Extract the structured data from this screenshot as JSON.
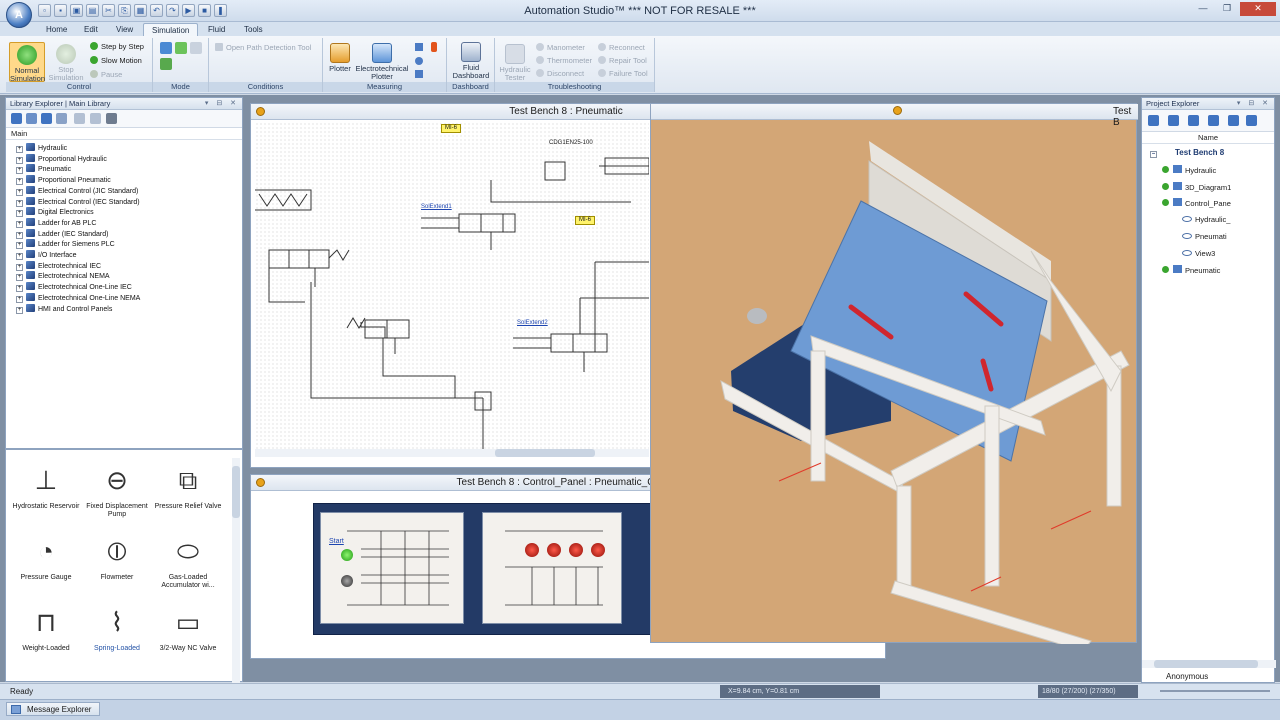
{
  "window": {
    "title": "Automation Studio™   *** NOT FOR RESALE ***",
    "logo_text": "A"
  },
  "ribbon_tabs": [
    "Home",
    "Edit",
    "View",
    "Simulation",
    "Fluid",
    "Tools"
  ],
  "ribbon": {
    "control": {
      "label": "Control",
      "normal_simulation": "Normal Simulation",
      "stop_simulation": "Stop Simulation",
      "step_by_step": "Step by Step",
      "slow_motion": "Slow Motion",
      "pause": "Pause"
    },
    "mode": {
      "label": "Mode"
    },
    "conditions": {
      "label": "Conditions",
      "open_path": "Open Path Detection Tool"
    },
    "measuring": {
      "label": "Measuring",
      "plotter": "Plotter",
      "electrotechnical_plotter": "Electrotechnical Plotter"
    },
    "dashboard": {
      "label": "Dashboard",
      "fluid_dashboard": "Fluid Dashboard"
    },
    "troubleshooting": {
      "label": "Troubleshooting",
      "hydraulic_tester": "Hydraulic Tester",
      "manometer": "Manometer",
      "thermometer": "Thermometer",
      "disconnect": "Disconnect",
      "reconnect": "Reconnect",
      "repair_tool": "Repair Tool",
      "failure_tool": "Failure Tool"
    }
  },
  "library": {
    "title": "Library Explorer | Main Library",
    "column": "Main",
    "items": [
      "Hydraulic",
      "Proportional Hydraulic",
      "Pneumatic",
      "Proportional Pneumatic",
      "Electrical Control (JIC Standard)",
      "Electrical Control (IEC Standard)",
      "Digital Electronics",
      "Ladder for AB PLC",
      "Ladder (IEC Standard)",
      "Ladder for Siemens PLC",
      "I/O Interface",
      "Electrotechnical IEC",
      "Electrotechnical NEMA",
      "Electrotechnical One-Line IEC",
      "Electrotechnical One-Line NEMA",
      "HMI and Control Panels"
    ],
    "symbols": [
      "Hydrostatic Reservoir",
      "Fixed Displacement Pump",
      "Pressure Relief Valve",
      "Pressure Gauge",
      "Flowmeter",
      "Gas-Loaded Accumulator wi...",
      "Weight-Loaded",
      "Spring-Loaded",
      "3/2-Way NC Valve"
    ]
  },
  "pneumatic_doc": {
    "title": "Test Bench 8 : Pneumatic",
    "labels": {
      "mi6a": "MI-6",
      "cyl": "CDG1EN25-100",
      "sol1": "SolExtend1",
      "mi6b": "MI-6",
      "sol2": "SolExtend2"
    }
  },
  "control_doc": {
    "title": "Test Bench 8 : Control_Panel : Pneumatic_Control",
    "start_label": "Start"
  },
  "view3d": {
    "title": "Test B"
  },
  "project": {
    "title": "Project Explorer",
    "column": "Name",
    "root": "Test Bench 8",
    "items": [
      "Hydraulic",
      "3D_Diagram1",
      "Control_Pane",
      "Hydraulic_",
      "Pneumati",
      "View3",
      "Pneumatic"
    ],
    "user": "Anonymous"
  },
  "status": {
    "ready": "Ready",
    "coords": "X=9.84 cm, Y=0.81 cm",
    "info": "18/80 (27/200) (27/350)"
  },
  "message_explorer": "Message Explorer",
  "colors": {
    "accent": "#4c7fc4",
    "panel_blue": "#6e9bd4",
    "floor": "#d4a97a"
  }
}
